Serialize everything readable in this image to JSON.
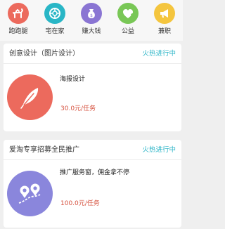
{
  "nav": {
    "items": [
      {
        "label": "跑跑腿",
        "icon": "dog-icon",
        "color": "#ec6a5d"
      },
      {
        "label": "宅在家",
        "icon": "lifebuoy-icon",
        "color": "#29b6c6"
      },
      {
        "label": "赚大钱",
        "icon": "money-bag-icon",
        "color": "#8a75d3"
      },
      {
        "label": "公益",
        "icon": "heart-plus-icon",
        "color": "#79c756"
      },
      {
        "label": "兼职",
        "icon": "megaphone-icon",
        "color": "#f4c53e"
      }
    ]
  },
  "tasks": [
    {
      "title": "创意设计（图片设计）",
      "status": "火热进行中",
      "description": "海报设计",
      "price": "30.0元/任务",
      "icon": "feather-icon",
      "color": "#ec6a5d"
    },
    {
      "title": "爱淘专享招募全民推广",
      "status": "火热进行中",
      "description": "推广服务窗，佣金拿不停",
      "price": "100.0元/任务",
      "icon": "map-pin-icon",
      "color": "#8a86dc"
    }
  ],
  "colors": {
    "status": "#2fb6c8",
    "price": "#d6523f",
    "background": "#efefef"
  }
}
